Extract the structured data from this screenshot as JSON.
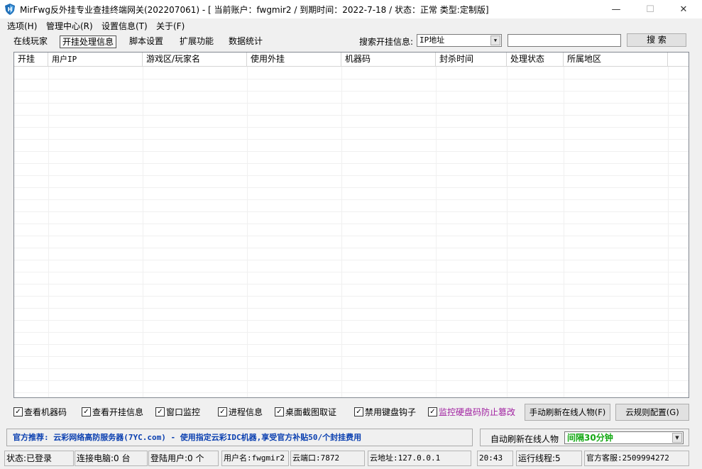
{
  "window": {
    "title": "MirFwg反外挂专业查挂终端网关(202207061)  - [ 当前账户：fwgmir2 / 到期时间：2022-7-18 / 状态：正常  类型:定制版]",
    "minimize_glyph": "—",
    "maximize_glyph": "☐",
    "close_glyph": "✕"
  },
  "menu": [
    "选项(H)",
    "管理中心(R)",
    "设置信息(T)",
    "关于(F)"
  ],
  "tabs": [
    "在线玩家",
    "开挂处理信息",
    "脚本设置",
    "扩展功能",
    "数据统计"
  ],
  "active_tab": "开挂处理信息",
  "search": {
    "label": "搜索开挂信息:",
    "field_value": "IP地址",
    "input_value": "",
    "button_label": "搜 索"
  },
  "table": {
    "columns": [
      "开挂",
      "用户IP",
      "游戏区/玩家名",
      "使用外挂",
      "机器码",
      "封杀时间",
      "处理状态",
      "所属地区"
    ],
    "rows": []
  },
  "checkboxes": [
    {
      "label": "查看机器码",
      "checked": true
    },
    {
      "label": "查看开挂信息",
      "checked": true
    },
    {
      "label": "窗口监控",
      "checked": true
    },
    {
      "label": "进程信息",
      "checked": true
    },
    {
      "label": "桌面截图取证",
      "checked": true
    },
    {
      "label": "禁用键盘钩子",
      "checked": true
    },
    {
      "label": "监控硬盘码防止篡改",
      "checked": true
    }
  ],
  "check_glyph": "✓",
  "buttons": {
    "manual_refresh": "手动刷新在线人物(F)",
    "cloud_rules": "云规则配置(G)"
  },
  "recommend_text": "官方推荐: 云彩网络高防服务器(7YC.com)  - 使用指定云彩IDC机器,享受官方补贴50/个封挂费用",
  "auto_refresh": {
    "label": "自动刷新在线人物",
    "value": "间隔30分钟"
  },
  "status_bar": [
    "状态:已登录",
    "连接电脑:0 台",
    "登陆用户:0 个",
    "用户名:fwgmir2",
    "云端口:7872",
    "云地址:127.0.0.1",
    "20:43",
    "运行线程:5",
    "官方客服:2509994272"
  ],
  "colors": {
    "recommend": "#0a3fb0",
    "interval": "#14a814",
    "purple_option": "#a020a0"
  },
  "icons": {
    "app": "shield-icon",
    "dropdown": "chevron-down-icon"
  }
}
